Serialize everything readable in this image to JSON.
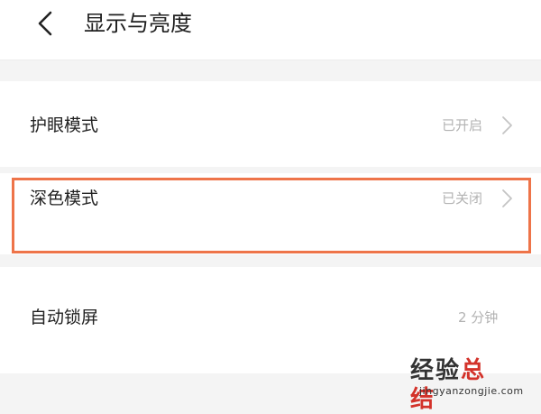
{
  "header": {
    "title": "显示与亮度",
    "back_icon": "back-chevron-icon"
  },
  "settings": [
    {
      "label": "护眼模式",
      "value": "已开启",
      "icon": "chevron-right-icon"
    },
    {
      "label": "深色模式",
      "value": "已关闭",
      "icon": "chevron-right-icon"
    },
    {
      "label": "自动锁屏",
      "value": "2 分钟"
    }
  ],
  "highlight_color": "#ee7449",
  "watermark": {
    "main_dark": "经验",
    "main_red": "总结",
    "sub": "jingyanzongjie.com"
  }
}
